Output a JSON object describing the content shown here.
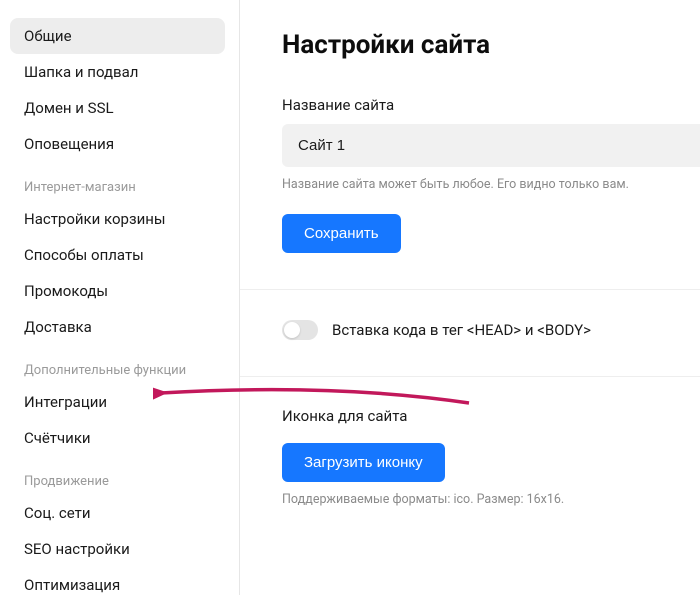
{
  "sidebar": {
    "group1": [
      {
        "label": "Общие",
        "active": true,
        "name": "sidebar-item-general"
      },
      {
        "label": "Шапка и подвал",
        "active": false,
        "name": "sidebar-item-header-footer"
      },
      {
        "label": "Домен и SSL",
        "active": false,
        "name": "sidebar-item-domain-ssl"
      },
      {
        "label": "Оповещения",
        "active": false,
        "name": "sidebar-item-notifications"
      }
    ],
    "section_shop_label": "Интернет-магазин",
    "group_shop": [
      {
        "label": "Настройки корзины",
        "name": "sidebar-item-cart"
      },
      {
        "label": "Способы оплаты",
        "name": "sidebar-item-payment"
      },
      {
        "label": "Промокоды",
        "name": "sidebar-item-promo"
      },
      {
        "label": "Доставка",
        "name": "sidebar-item-delivery"
      }
    ],
    "section_extra_label": "Дополнительные функции",
    "group_extra": [
      {
        "label": "Интеграции",
        "name": "sidebar-item-integrations"
      },
      {
        "label": "Счётчики",
        "name": "sidebar-item-counters"
      }
    ],
    "section_promo_label": "Продвижение",
    "group_promo": [
      {
        "label": "Соц. сети",
        "name": "sidebar-item-social"
      },
      {
        "label": "SEO настройки",
        "name": "sidebar-item-seo"
      },
      {
        "label": "Оптимизация",
        "name": "sidebar-item-optimization"
      }
    ]
  },
  "main": {
    "title": "Настройки сайта",
    "site_name_label": "Название сайта",
    "site_name_value": "Сайт 1",
    "site_name_help": "Название сайта может быть любое. Его видно только вам.",
    "save_button": "Сохранить",
    "toggle_label": "Вставка кода в тег <HEAD> и <BODY>",
    "favicon_heading": "Иконка для сайта",
    "upload_button": "Загрузить иконку",
    "upload_help": "Поддерживаемые форматы: ico. Размер: 16x16."
  },
  "annotation": {
    "arrow_color": "#c2185b"
  }
}
